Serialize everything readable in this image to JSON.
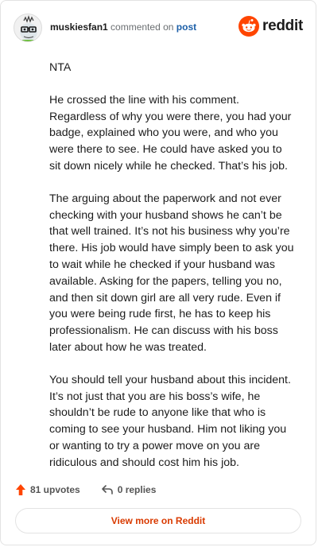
{
  "comment": {
    "username": "muskiesfan1",
    "action_text": "commented on",
    "post_link": "post",
    "paragraphs": [
      "NTA",
      "He crossed the line with his comment. Regardless of why you were there, you had your badge, explained who you were, and who you were there to see. He could have asked you to sit down nicely while he checked. That’s his job.",
      "The arguing about the paperwork and not ever checking with your husband shows he can’t be that well trained. It’s not his business why you’re there. His job would have simply been to ask you to wait while he checked if your husband was available. Asking for the papers, telling you no, and then sit down girl are all very rude. Even if you were being rude first, he has to keep his professionalism. He can discuss with his boss later about how he was treated.",
      "You should tell your husband about this incident. It’s not just that you are his boss’s wife, he shouldn’t be rude to anyone like that who is coming to see your husband. Him not liking you or wanting to try a power move on you are ridiculous and should cost him his job."
    ]
  },
  "brand": {
    "name": "reddit",
    "color": "#ff4500"
  },
  "footer": {
    "upvotes": "81 upvotes",
    "replies": "0 replies",
    "view_more": "View more on Reddit",
    "accent": "#d93a00"
  }
}
